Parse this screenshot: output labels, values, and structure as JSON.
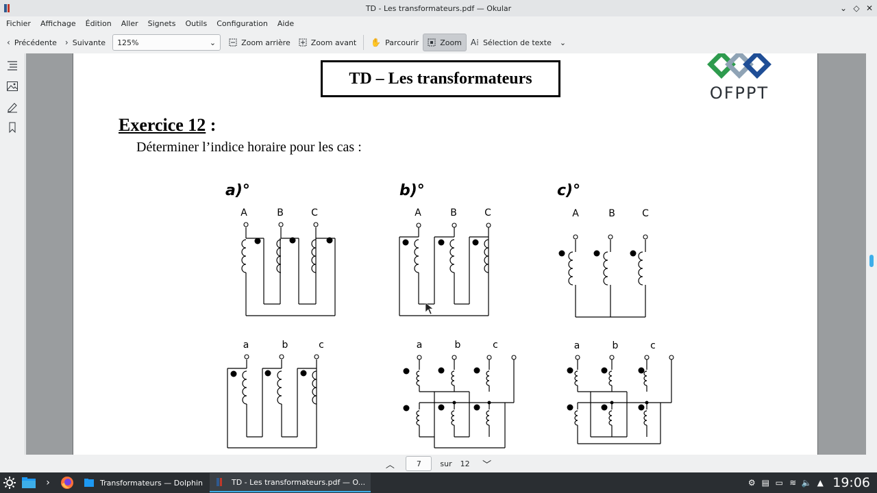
{
  "window": {
    "title": "TD - Les transformateurs.pdf — Okular"
  },
  "menu": [
    "Fichier",
    "Affichage",
    "Édition",
    "Aller",
    "Signets",
    "Outils",
    "Configuration",
    "Aide"
  ],
  "toolbar": {
    "previous": "Précédente",
    "next": "Suivante",
    "zoom_value": "125%",
    "zoom_out": "Zoom arrière",
    "zoom_in": "Zoom avant",
    "browse": "Parcourir",
    "zoom_tool": "Zoom",
    "text_selection": "Sélection de texte"
  },
  "document": {
    "title": "TD – Les transformateurs",
    "logo_text": "OFPPT",
    "exercise_number": "Exercice 12",
    "exercise_colon": " :",
    "instruction": "Déterminer l’indice horaire pour les cas :",
    "cases": [
      "a)°",
      "b)°",
      "c)°"
    ],
    "primary_labels": [
      "A",
      "B",
      "C"
    ],
    "secondary_labels": [
      "a",
      "b",
      "c"
    ]
  },
  "pagebar": {
    "current_page": "7",
    "of_label": "sur",
    "total_pages": "12"
  },
  "taskbar": {
    "tasks": [
      "Transformateurs — Dolphin",
      "TD - Les transformateurs.pdf — O..."
    ],
    "clock": "19:06"
  },
  "colors": {
    "accent": "#3daee9",
    "taskbar": "#2a2e32",
    "logo_green": "#2e9b4e",
    "logo_blue": "#1f4e96"
  }
}
